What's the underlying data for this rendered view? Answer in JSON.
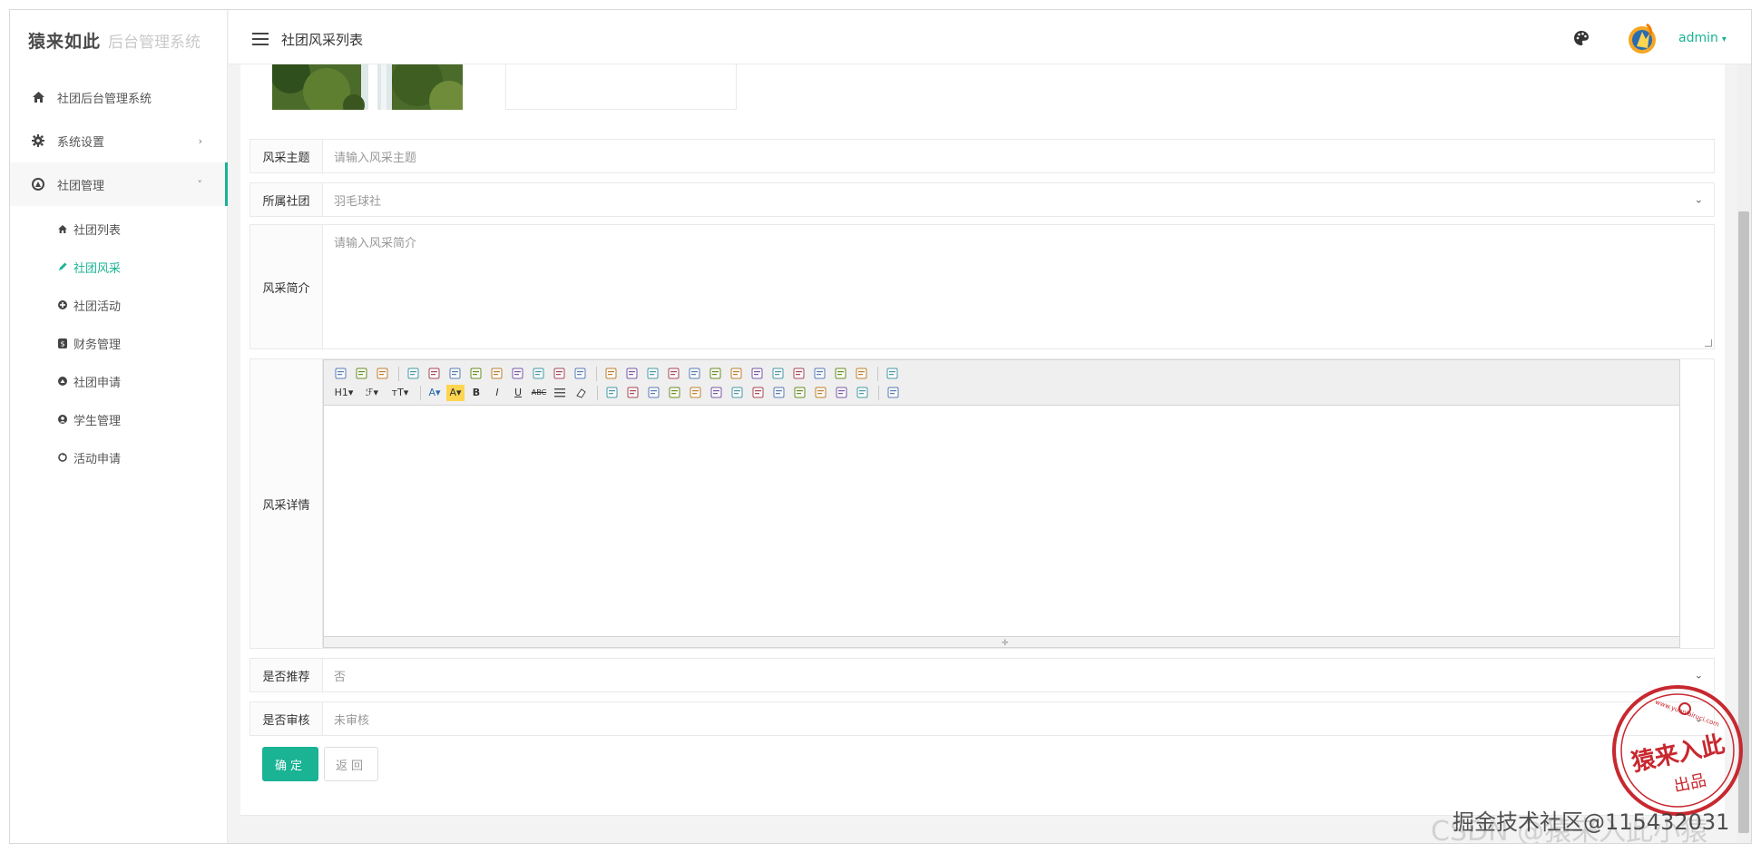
{
  "app": {
    "logo_main": "猿来如此",
    "logo_sub": "后台管理系统"
  },
  "sidebar": {
    "items": [
      {
        "label": "社团后台管理系统",
        "icon": "home-icon"
      },
      {
        "label": "系统设置",
        "icon": "gear-icon",
        "chevron": "›"
      },
      {
        "label": "社团管理",
        "icon": "club-icon",
        "chevron": "˅"
      }
    ],
    "sub_items": [
      {
        "label": "社团列表",
        "icon": "home-icon"
      },
      {
        "label": "社团风采",
        "icon": "pencil-icon"
      },
      {
        "label": "社团活动",
        "icon": "plus-circle-icon"
      },
      {
        "label": "财务管理",
        "icon": "dollar-icon"
      },
      {
        "label": "社团申请",
        "icon": "apply-icon"
      },
      {
        "label": "学生管理",
        "icon": "user-circle-icon"
      },
      {
        "label": "活动申请",
        "icon": "refresh-icon"
      }
    ]
  },
  "header": {
    "page_title": "社团风采列表",
    "user": "admin",
    "user_caret": "▾"
  },
  "form": {
    "theme_label": "风采主题",
    "theme_placeholder": "请输入风采主题",
    "club_label": "所属社团",
    "club_value": "羽毛球社",
    "intro_label": "风采简介",
    "intro_placeholder": "请输入风采简介",
    "detail_label": "风采详情",
    "recommend_label": "是否推荐",
    "recommend_value": "否",
    "audit_label": "是否审核",
    "audit_value": "未审核",
    "ok_button": "确定",
    "back_button": "返回",
    "select_caret": "⌄"
  },
  "editor": {
    "row1_tools": [
      "source",
      "undo",
      "redo",
      "|",
      "preview",
      "print",
      "template",
      "bookmark",
      "cut",
      "copy",
      "paste",
      "paste-text",
      "paste-word",
      "|",
      "align-left",
      "align-center",
      "align-right",
      "justify",
      "ordered-list",
      "bullet-list",
      "indent",
      "outdent",
      "subscript",
      "superscript",
      "clear-format",
      "quick-format",
      "select-all",
      "|",
      "fullscreen"
    ],
    "row2_labels": {
      "heading": "H1▾",
      "font": "ℱ▾",
      "size": "тT▾",
      "forecolor": "A▾",
      "hilite": "A▾",
      "bold": "B",
      "italic": "I",
      "underline": "U",
      "strike": "ABC"
    },
    "row2_tools": [
      "|",
      "image",
      "multi-image",
      "flash",
      "media",
      "insert-file",
      "table",
      "code",
      "emoticons",
      "baidu-map",
      "page-break",
      "anchor",
      "link",
      "unlink",
      "|",
      "help"
    ]
  },
  "watermark": {
    "text": "掘金技术社区@115432031",
    "faint": "CSDN @猿来入此小猿",
    "stamp_top": "www.yuanlairuci.com",
    "stamp_main": "猿来入此",
    "stamp_sub": "出品"
  },
  "colors": {
    "accent": "#1ab394",
    "stamp": "#c8282f"
  }
}
